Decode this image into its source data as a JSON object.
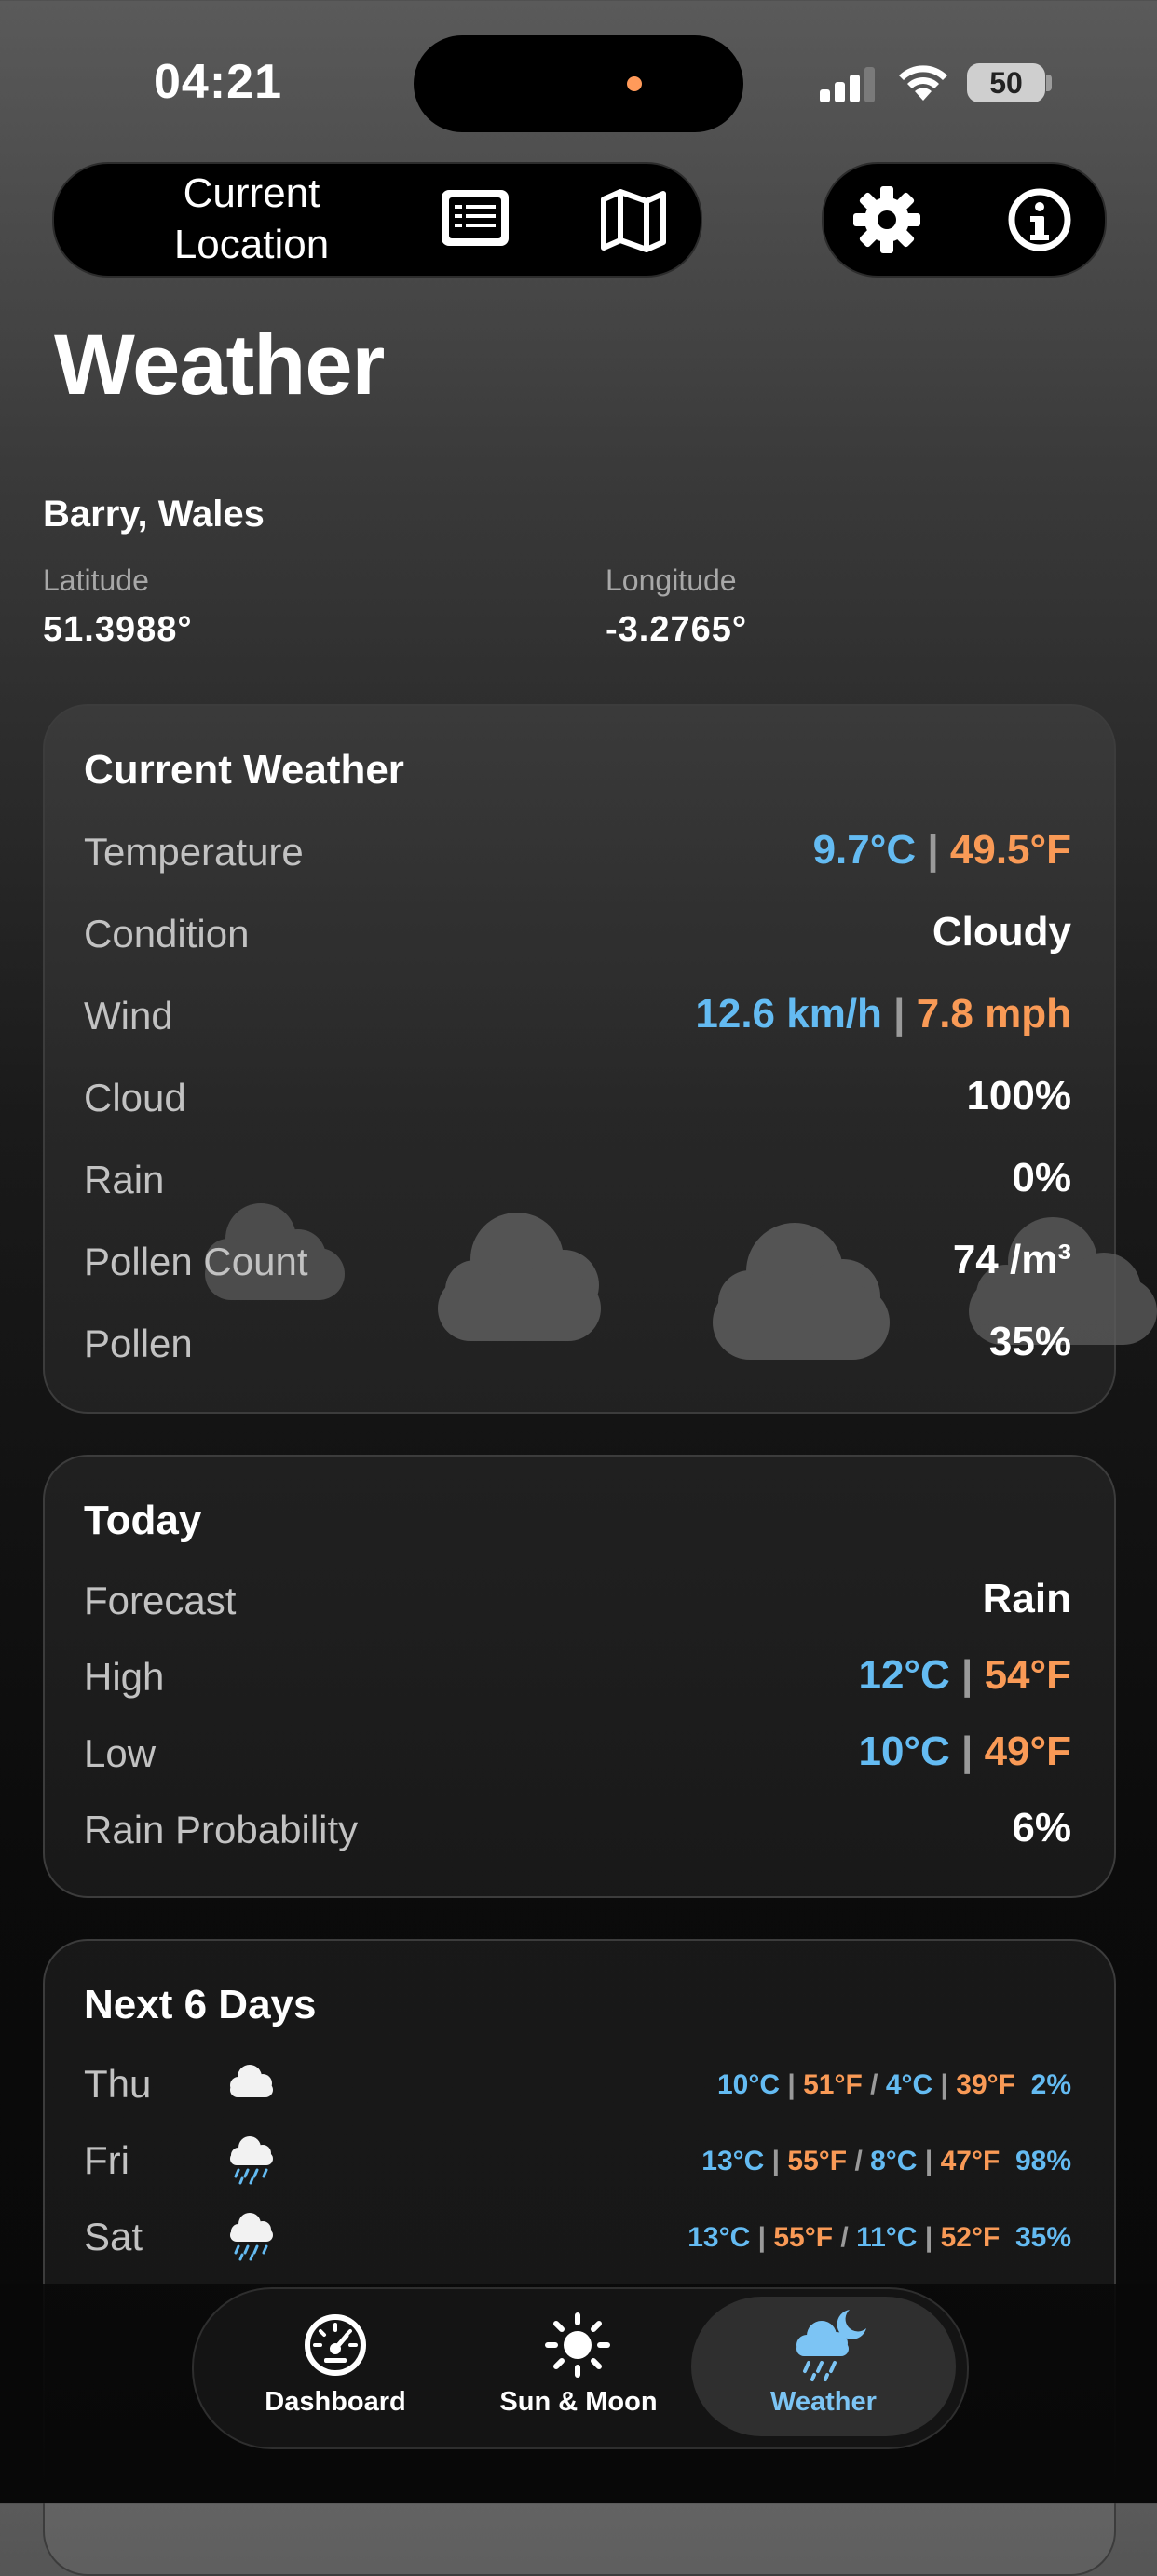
{
  "status_bar": {
    "time": "04:21",
    "battery": "50",
    "icons": [
      "signal-icon",
      "wifi-icon",
      "battery-icon"
    ]
  },
  "toolbar": {
    "location_label": "Current Location",
    "icons": [
      "list-icon",
      "map-icon",
      "gear-icon",
      "info-icon"
    ]
  },
  "page": {
    "title": "Weather"
  },
  "location": {
    "name": "Barry, Wales",
    "latitude_label": "Latitude",
    "latitude": "51.3988°",
    "longitude_label": "Longitude",
    "longitude": "-3.2765°"
  },
  "current_weather": {
    "title": "Current Weather",
    "rows": [
      {
        "label": "Temperature",
        "metric": "9.7°C",
        "separator": "|",
        "imperial": "49.5°F"
      },
      {
        "label": "Condition",
        "value": "Cloudy"
      },
      {
        "label": "Wind",
        "metric": "12.6 km/h",
        "separator": "|",
        "imperial": "7.8 mph"
      },
      {
        "label": "Cloud",
        "value": "100%"
      },
      {
        "label": "Rain",
        "value": "0%"
      },
      {
        "label": "Pollen Count",
        "value": "74 /m³"
      },
      {
        "label": "Pollen",
        "value": "35%"
      }
    ]
  },
  "today": {
    "title": "Today",
    "rows": [
      {
        "label": "Forecast",
        "value": "Rain"
      },
      {
        "label": "High",
        "metric": "12°C",
        "separator": "|",
        "imperial": "54°F"
      },
      {
        "label": "Low",
        "metric": "10°C",
        "separator": "|",
        "imperial": "49°F"
      },
      {
        "label": "Rain Probability",
        "value": "6%"
      }
    ]
  },
  "next_days": {
    "title": "Next 6 Days",
    "days": [
      {
        "day": "Thu",
        "icon": "cloud-icon",
        "high_c": "10°C",
        "high_f": "51°F",
        "low_c": "4°C",
        "low_f": "39°F",
        "precip": "2%"
      },
      {
        "day": "Fri",
        "icon": "rain-cloud-icon",
        "high_c": "13°C",
        "high_f": "55°F",
        "low_c": "8°C",
        "low_f": "47°F",
        "precip": "98%"
      },
      {
        "day": "Sat",
        "icon": "rain-cloud-icon",
        "high_c": "13°C",
        "high_f": "55°F",
        "low_c": "11°C",
        "low_f": "52°F",
        "precip": "35%"
      }
    ],
    "bar_sep": "|",
    "slash_sep": "/"
  },
  "tabbar": {
    "tabs": [
      {
        "label": "Dashboard",
        "icon": "speedometer-icon",
        "active": false
      },
      {
        "label": "Sun & Moon",
        "icon": "sun-icon",
        "active": false
      },
      {
        "label": "Weather",
        "icon": "cloud-moon-rain-icon",
        "active": true
      }
    ]
  },
  "colors": {
    "metric": "#64bbf2",
    "imperial": "#f99a56",
    "active_tab": "#7cc4f4"
  }
}
